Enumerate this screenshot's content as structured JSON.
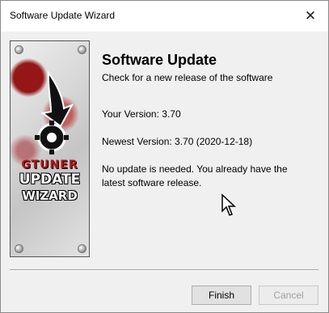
{
  "window": {
    "title": "Software Update Wizard"
  },
  "header": {
    "heading": "Software Update",
    "subtitle": "Check for a new release of the software"
  },
  "versions": {
    "your_version": "Your Version: 3.70",
    "newest_version": "Newest Version: 3.70 (2020-12-18)"
  },
  "message": {
    "line1": "No update is needed. You already have the",
    "line2": "latest software release."
  },
  "banner": {
    "brand": "GTUNER",
    "update": "UPDATE",
    "wizard": "WIZARD"
  },
  "buttons": {
    "finish": "Finish",
    "cancel": "Cancel"
  },
  "icons": {
    "close": "close-icon"
  },
  "colors": {
    "brand_red": "#b21616",
    "window_bg": "#f0f0f0"
  }
}
